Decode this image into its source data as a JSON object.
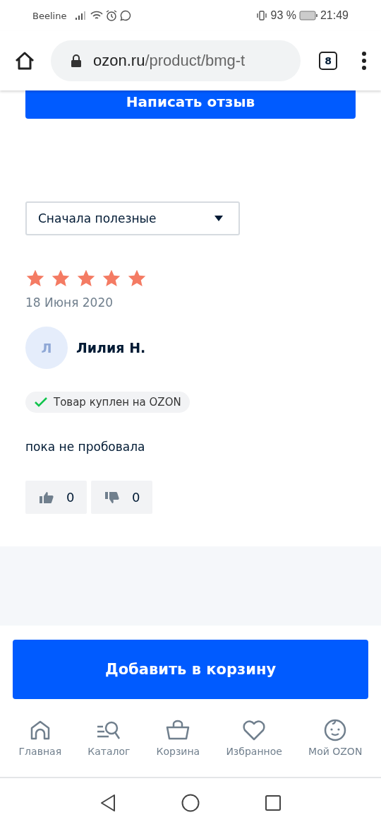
{
  "status_bar": {
    "carrier": "Beeline",
    "battery": "93 %",
    "time": "21:49"
  },
  "browser": {
    "url_host": "ozon.ru",
    "url_path": "/product/bmg-t",
    "tab_count": "8"
  },
  "write_review_button": "Написать отзыв",
  "sort_dropdown": {
    "value": "Сначала полезные"
  },
  "review": {
    "stars": 5,
    "date": "18 Июня 2020",
    "avatar_letter": "Л",
    "author": "Лилия Н.",
    "badge": "Товар куплен на OZON",
    "text": "пока не пробовала",
    "likes": "0",
    "dislikes": "0"
  },
  "add_to_cart_button": "Добавить в корзину",
  "bottom_nav": [
    {
      "kind": "home",
      "label": "Главная"
    },
    {
      "kind": "catalog",
      "label": "Каталог"
    },
    {
      "kind": "cart",
      "label": "Корзина"
    },
    {
      "kind": "favorites",
      "label": "Избранное"
    },
    {
      "kind": "profile",
      "label": "Мой OZON"
    }
  ]
}
